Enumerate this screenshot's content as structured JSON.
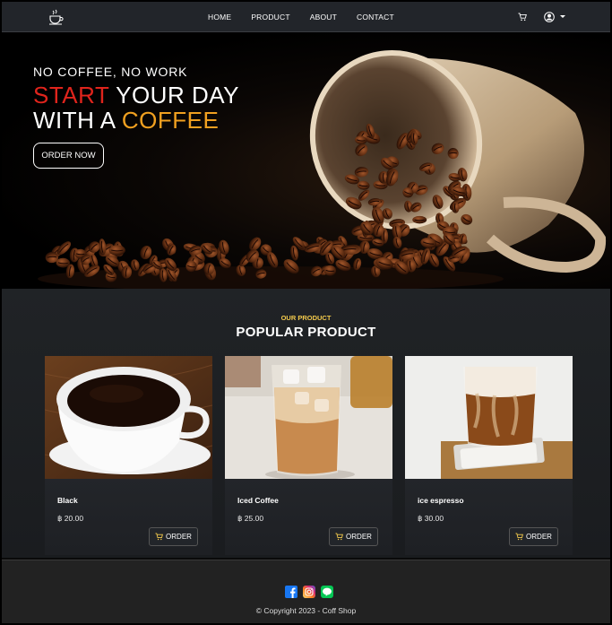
{
  "nav": {
    "links": [
      "HOME",
      "PRODUCT",
      "ABOUT",
      "CONTACT"
    ],
    "icons": [
      "coffee-cup-icon",
      "cart-icon",
      "user-icon",
      "chevron-down-icon"
    ]
  },
  "hero": {
    "kicker": "NO COFFEE, NO WORK",
    "line1_accent": "START",
    "line1_rest": " YOUR DAY",
    "line2_prefix": "WITH A ",
    "line2_accent": "COFFEE",
    "order_button": "ORDER NOW",
    "accent_red": "#e0241c",
    "accent_orange": "#f0a020"
  },
  "products": {
    "kicker": "OUR PRODUCT",
    "heading": "POPULAR PRODUCT",
    "items": [
      {
        "name": "Black",
        "price": "฿ 20.00",
        "button": "ORDER"
      },
      {
        "name": "Iced Coffee",
        "price": "฿ 25.00",
        "button": "ORDER"
      },
      {
        "name": "ice espresso",
        "price": "฿ 30.00",
        "button": "ORDER"
      }
    ]
  },
  "footer": {
    "socials": [
      "facebook-icon",
      "instagram-icon",
      "line-icon"
    ],
    "copyright": "© Copyright 2023  - Coff Shop"
  }
}
